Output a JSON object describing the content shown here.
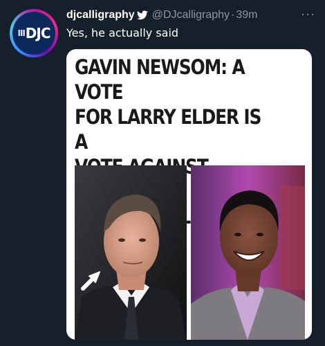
{
  "tweet": {
    "author_name": "djcalligraphy",
    "author_handle": "@DJcalligraphy",
    "separator": "·",
    "time_ago": "39m",
    "text": "Yes, he actually said",
    "avatar_text": "DJC",
    "more_glyph": "···"
  },
  "media": {
    "headline": "GAVIN NEWSOM: A VOTE\nFOR LARRY ELDER IS A\nVOTE AGAINST ‘DIVERSITY’\nAND ‘RACIAL JUSTICE’",
    "left_photo": "newsom-photo",
    "right_photo": "elder-photo"
  },
  "colors": {
    "background": "#15202b",
    "secondary_text": "#8b98a5",
    "card_background": "#ffffff"
  }
}
